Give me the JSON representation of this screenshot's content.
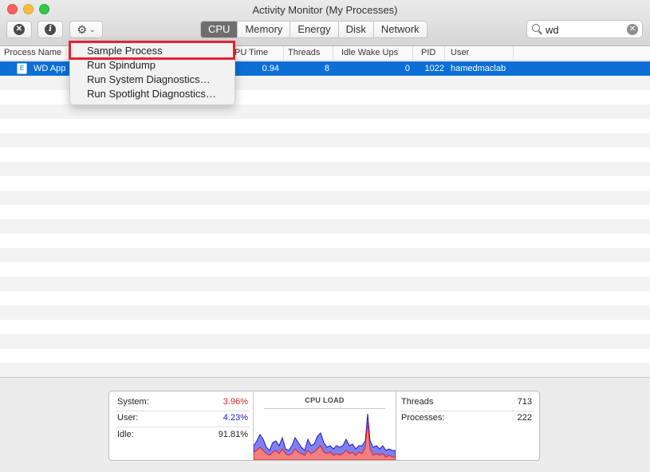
{
  "window": {
    "title": "Activity Monitor (My Processes)"
  },
  "toolbar": {
    "stop_icon_glyph": "✕",
    "info_icon_glyph": "i",
    "gear_icon_glyph": "⚙",
    "chevron_glyph": "⌄",
    "tabs": [
      "CPU",
      "Memory",
      "Energy",
      "Disk",
      "Network"
    ],
    "active_tab": "CPU"
  },
  "search": {
    "value": "wd",
    "clear_glyph": "✕"
  },
  "table": {
    "columns": [
      "Process Name",
      "PU Time",
      "Threads",
      "Idle Wake Ups",
      "PID",
      "User"
    ],
    "rows": [
      {
        "name": "WD App",
        "cpu_time": "0.94",
        "threads": "8",
        "idle_wake_ups": "0",
        "pid": "1022",
        "user": "hamedmaclab",
        "icon_glyph": "E"
      }
    ]
  },
  "menu": {
    "items": [
      "Sample Process",
      "Run Spindump",
      "Run System Diagnostics…",
      "Run Spotlight Diagnostics…"
    ],
    "highlighted": "Sample Process",
    "highlight_color": "#e52230"
  },
  "stats": {
    "system_label": "System:",
    "system_value": "3.96%",
    "system_color": "#e02020",
    "user_label": "User:",
    "user_value": "4.23%",
    "user_color": "#1a1ad0",
    "idle_label": "Idle:",
    "idle_value": "91.81%",
    "cpu_load_title": "CPU LOAD",
    "threads_label": "Threads",
    "threads_value": "713",
    "processes_label": "Processes:",
    "processes_value": "222"
  },
  "colors": {
    "selection": "#0b6fd6",
    "system_fill": "#f08080",
    "user_fill": "#8080f0"
  }
}
